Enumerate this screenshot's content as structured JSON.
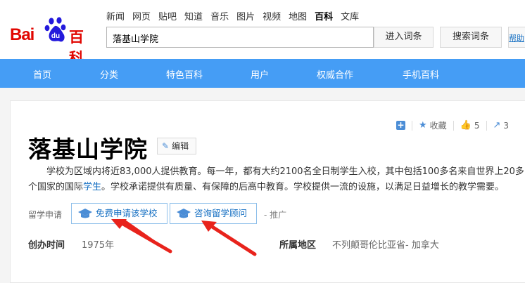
{
  "brand": {
    "logo_left": "Bai",
    "logo_paw": "du",
    "logo_right": "百科"
  },
  "top_nav": [
    "新闻",
    "网页",
    "贴吧",
    "知道",
    "音乐",
    "图片",
    "视频",
    "地图",
    "百科",
    "文库"
  ],
  "search": {
    "value": "落基山学院",
    "enter_label": "进入词条",
    "search_label": "搜索词条",
    "help_label": "帮助"
  },
  "blue_nav": [
    "首页",
    "分类",
    "特色百科",
    "用户",
    "权威合作",
    "手机百科"
  ],
  "tools": {
    "collect_label": "收藏",
    "like_count": "5",
    "share_count": "3"
  },
  "entry": {
    "title": "落基山学院",
    "edit_label": "编辑",
    "summary_a": "学校为区域内将近83,000人提供教育。每一年，都有大约2100名全日制学生入校，其中包括100多名来自世界上20多个国家的国际",
    "summary_link": "学生",
    "summary_b": "。学校承诺提供有质量、有保障的后高中教育。学校提供一流的设施，以满足日益增长的教学需要。"
  },
  "study": {
    "label": "留学申请",
    "apply_label": "免费申请该学校",
    "consult_label": "咨询留学顾问",
    "promo_label": "- 推广"
  },
  "info": [
    {
      "key": "创办时间",
      "value": "1975年"
    },
    {
      "key": "所属地区",
      "value": "不列颠哥伦比亚省- 加拿大"
    }
  ],
  "colors": {
    "brand_red": "#e10601",
    "brand_blue": "#2319dc",
    "nav_blue": "#459df5",
    "link_blue": "#136ec2",
    "arrow_red": "#e8231c"
  }
}
